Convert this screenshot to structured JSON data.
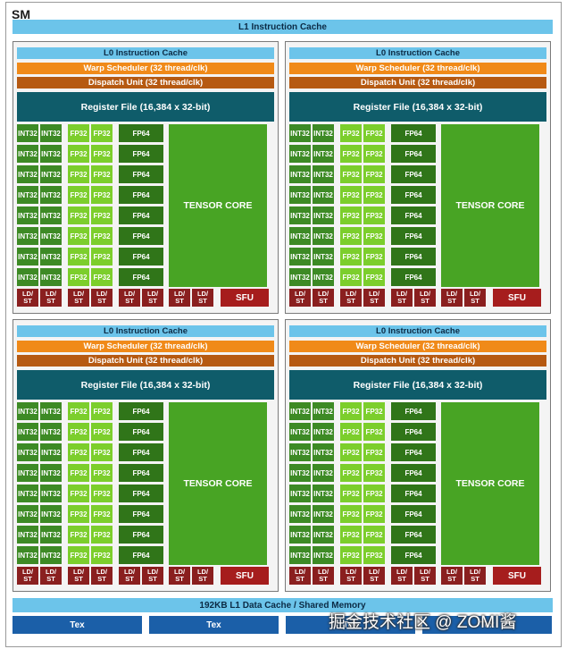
{
  "sm_label": "SM",
  "l1_instruction_cache": "L1 Instruction Cache",
  "partition": {
    "l0_cache": "L0 Instruction Cache",
    "warp_scheduler": "Warp Scheduler (32 thread/clk)",
    "dispatch_unit": "Dispatch Unit (32 thread/clk)",
    "register_file": "Register File (16,384 x 32-bit)",
    "int32": "INT32",
    "fp32": "FP32",
    "fp64": "FP64",
    "tensor_core": "TENSOR CORE",
    "ldst_top": "LD/",
    "ldst_bottom": "ST",
    "sfu": "SFU",
    "rows": 8,
    "ldst_units": 8
  },
  "partitions_count": 4,
  "l1_data_cache": "192KB L1 Data Cache / Shared Memory",
  "tex_units": [
    "Tex",
    "Tex",
    "Tex",
    "Tex"
  ],
  "watermark": "掘金技术社区 @ ZOMI酱",
  "colors": {
    "cache": "#6cc4ea",
    "warp": "#f08a19",
    "dispatch": "#b65a12",
    "register": "#0f5c6a",
    "int32": "#3d8a25",
    "fp32": "#7cce2c",
    "fp64": "#307519",
    "tensor": "#48a424",
    "ldst": "#8a1f1f",
    "sfu": "#a61d1d",
    "tex": "#1b5fa8"
  }
}
